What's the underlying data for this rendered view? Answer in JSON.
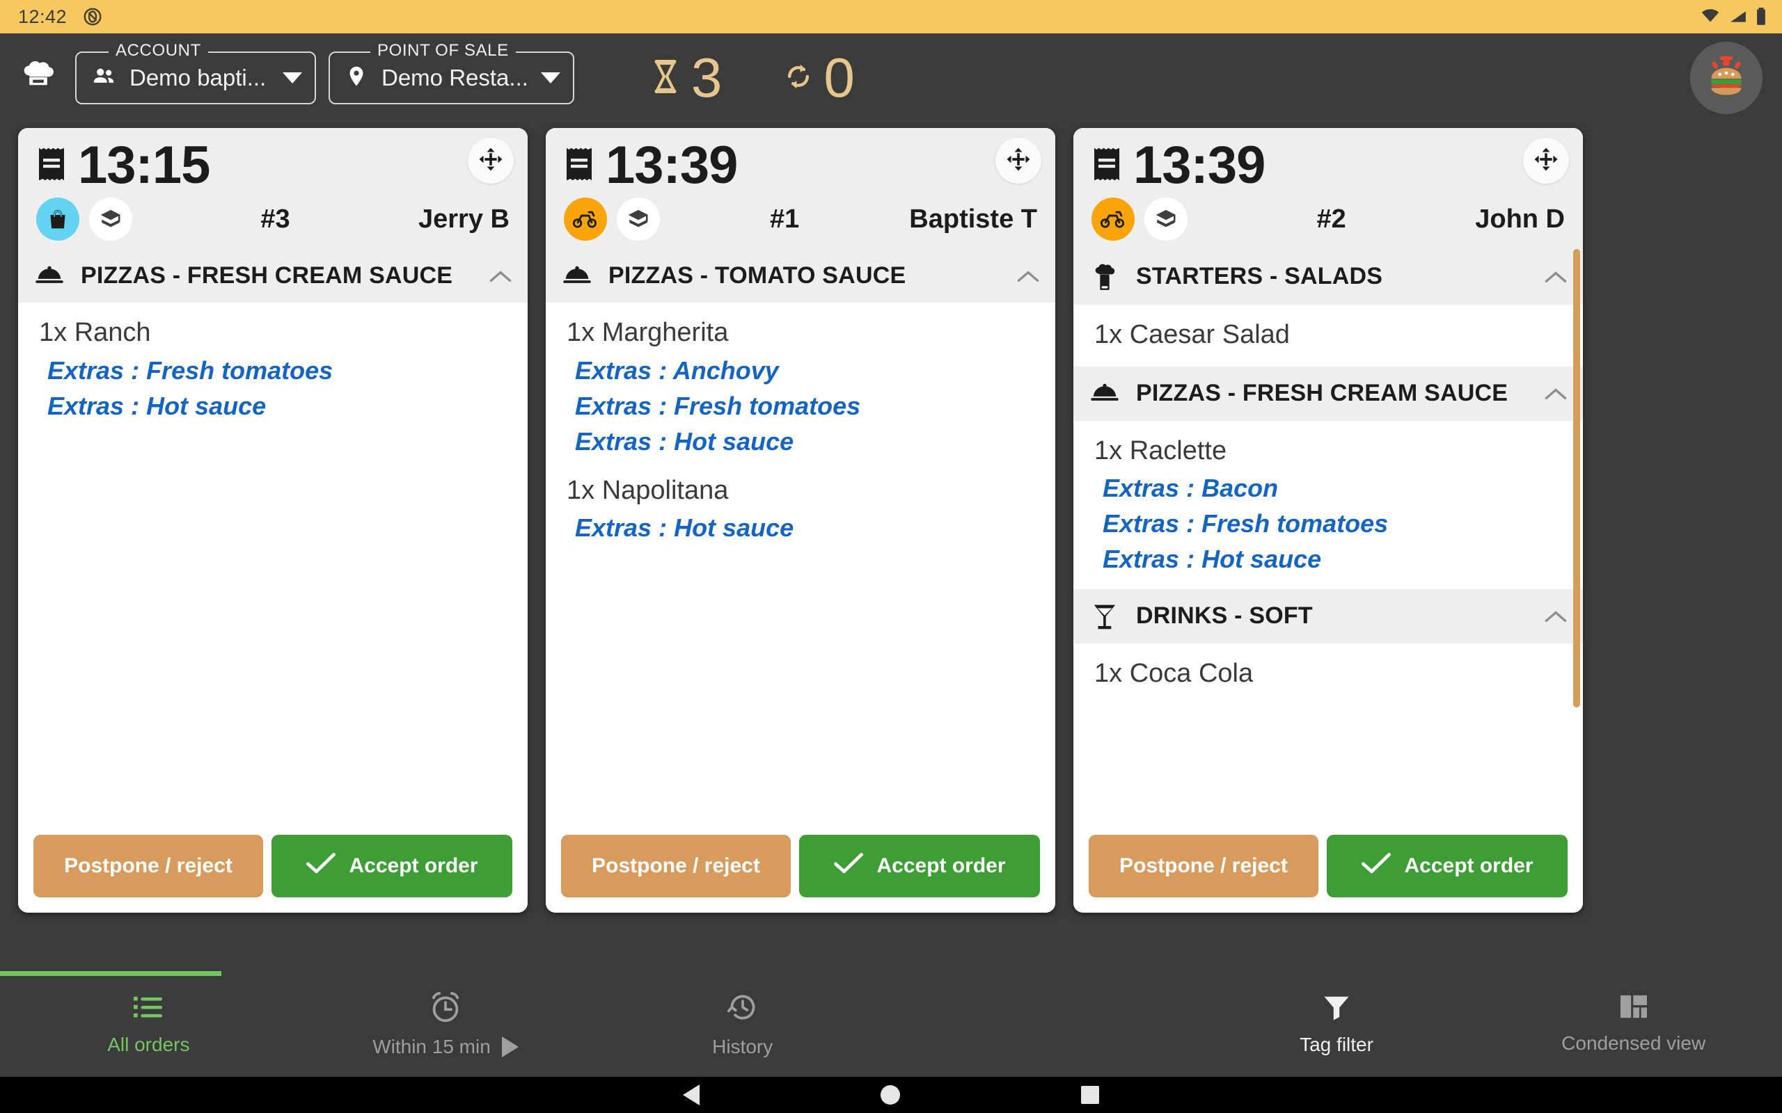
{
  "status_bar": {
    "time": "12:42",
    "icons": [
      "rotation-locked-icon",
      "wifi-icon",
      "signal-icon",
      "battery-icon"
    ]
  },
  "header": {
    "logo_icon": "chef-hat-icon",
    "account": {
      "legend": "ACCOUNT",
      "icon": "people-icon",
      "value": "Demo bapti...",
      "caret": "chevron-down-icon"
    },
    "point_of_sale": {
      "legend": "POINT OF SALE",
      "icon": "location-pin-icon",
      "value": "Demo Resta...",
      "caret": "chevron-down-icon"
    },
    "counters": [
      {
        "icon": "hourglass-icon",
        "value": "3",
        "name": "pending-orders-counter"
      },
      {
        "icon": "sync-icon",
        "value": "0",
        "name": "syncing-orders-counter"
      }
    ],
    "avatar_icon": "burger-logo-icon",
    "accent_color": "#e7c68e"
  },
  "orders": [
    {
      "time": "13:15",
      "receipt_icon": "receipt-icon",
      "move_icon": "move-arrows-icon",
      "type_badge": {
        "icon": "takeaway-bag-icon",
        "color": "#62d3f0"
      },
      "channel_badge": {
        "icon": "layers-stack-icon",
        "color": "#ffffff"
      },
      "order_number": "#3",
      "customer": "Jerry B",
      "has_move_button": true,
      "scroll": {
        "visible": false,
        "top_pct": 0,
        "height_pct": 0
      },
      "categories": [
        {
          "icon": "cloche-icon",
          "title": "PIZZAS - FRESH CREAM SAUCE",
          "collapse_icon": "chevron-up-icon",
          "items": [
            {
              "name": "1x Ranch",
              "extras": [
                "Extras : Fresh tomatoes",
                "Extras : Hot sauce"
              ]
            }
          ]
        }
      ],
      "actions": {
        "postpone_label": "Postpone / reject",
        "accept_label": "Accept order",
        "accept_icon": "check-icon"
      }
    },
    {
      "time": "13:39",
      "receipt_icon": "receipt-icon",
      "move_icon": "move-arrows-icon",
      "type_badge": {
        "icon": "delivery-scooter-icon",
        "color": "#fba40a"
      },
      "channel_badge": {
        "icon": "layers-stack-icon",
        "color": "#ffffff"
      },
      "order_number": "#1",
      "customer": "Baptiste T",
      "has_move_button": true,
      "scroll": {
        "visible": false,
        "top_pct": 0,
        "height_pct": 0
      },
      "categories": [
        {
          "icon": "cloche-icon",
          "title": "PIZZAS - TOMATO SAUCE",
          "collapse_icon": "chevron-up-icon",
          "items": [
            {
              "name": "1x Margherita",
              "extras": [
                "Extras : Anchovy",
                "Extras : Fresh tomatoes",
                "Extras : Hot sauce"
              ]
            },
            {
              "name": "1x Napolitana",
              "extras": [
                "Extras : Hot sauce"
              ]
            }
          ]
        }
      ],
      "actions": {
        "postpone_label": "Postpone / reject",
        "accept_label": "Accept order",
        "accept_icon": "check-icon"
      }
    },
    {
      "time": "13:39",
      "receipt_icon": "receipt-icon",
      "move_icon": "move-arrows-icon",
      "type_badge": {
        "icon": "delivery-scooter-icon",
        "color": "#fba40a"
      },
      "channel_badge": {
        "icon": "layers-stack-icon",
        "color": "#ffffff"
      },
      "order_number": "#2",
      "customer": "John D",
      "has_move_button": true,
      "scroll": {
        "visible": true,
        "top_pct": 2,
        "height_pct": 80,
        "color": "#d39f55"
      },
      "categories": [
        {
          "icon": "chef-hat-icon",
          "title": "STARTERS - SALADS",
          "collapse_icon": "chevron-up-icon",
          "items": [
            {
              "name": "1x Caesar Salad",
              "extras": []
            }
          ]
        },
        {
          "icon": "cloche-icon",
          "title": "PIZZAS - FRESH CREAM SAUCE",
          "collapse_icon": "chevron-up-icon",
          "items": [
            {
              "name": "1x Raclette",
              "extras": [
                "Extras : Bacon",
                "Extras : Fresh tomatoes",
                "Extras : Hot sauce"
              ]
            }
          ]
        },
        {
          "icon": "cocktail-glass-icon",
          "title": "DRINKS - SOFT",
          "collapse_icon": "chevron-up-icon",
          "items": [
            {
              "name": "1x Coca Cola",
              "extras": []
            }
          ]
        }
      ],
      "actions": {
        "postpone_label": "Postpone / reject",
        "accept_label": "Accept order",
        "accept_icon": "check-icon"
      }
    }
  ],
  "bottom_nav": {
    "items": [
      {
        "name": "all-orders",
        "icon": "list-icon",
        "label": "All orders",
        "active": true
      },
      {
        "name": "within-15-min",
        "icon": "alarm-clock-icon",
        "label": "Within 15 min",
        "active": false,
        "trailing_icon": "play-triangle-icon"
      },
      {
        "name": "history",
        "icon": "history-clock-icon",
        "label": "History",
        "active": false
      },
      {
        "name": "spacer",
        "icon": "",
        "label": "",
        "active": false
      },
      {
        "name": "tag-filter",
        "icon": "funnel-icon",
        "label": "Tag filter",
        "active": false,
        "bright": true
      },
      {
        "name": "condensed-view",
        "icon": "dashboard-grid-icon",
        "label": "Condensed view",
        "active": false
      }
    ],
    "active_color": "#73c661"
  },
  "system_nav": {
    "back": "back-triangle-icon",
    "home": "home-circle-icon",
    "recents": "recents-square-icon"
  },
  "colors": {
    "status_bar_bg": "#f8c860",
    "app_bg": "#3b3b3b",
    "card_bg": "#ffffff",
    "category_bg": "#eeeeee",
    "extras_text": "#1565c0",
    "accept_green": "#3d9e35",
    "postpone_tan": "#d79b5e"
  }
}
